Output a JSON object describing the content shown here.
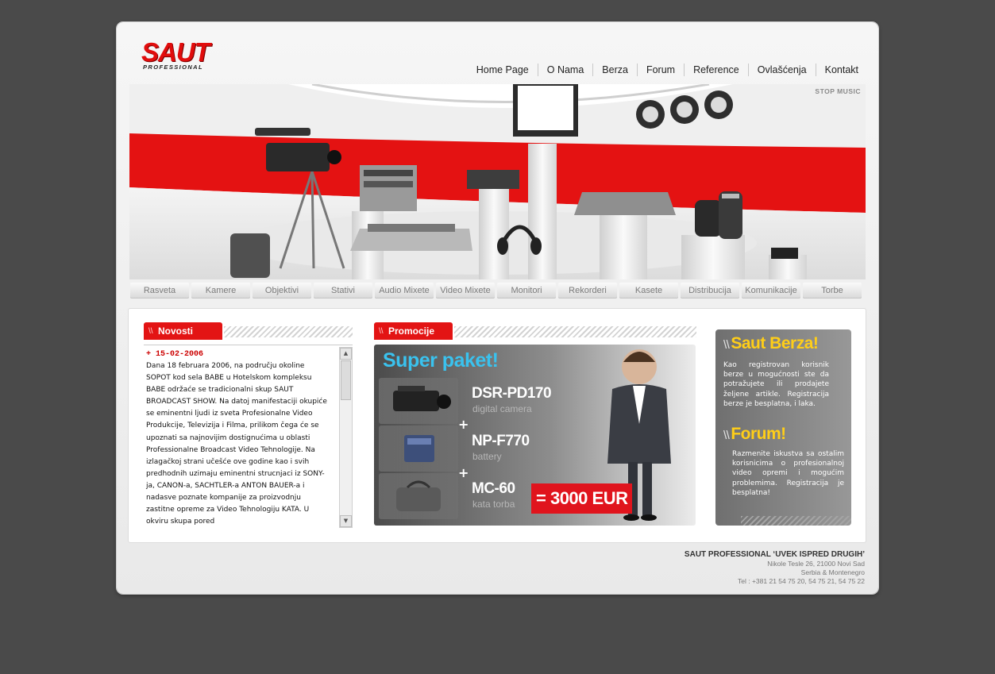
{
  "logo": {
    "main": "SAUT",
    "sub": "PROFESSIONAL"
  },
  "topnav": [
    "Home Page",
    "O Nama",
    "Berza",
    "Forum",
    "Reference",
    "Ovlašćenja",
    "Kontakt"
  ],
  "banner": {
    "stop_music": "STOP MUSIC"
  },
  "categories": [
    "Rasveta",
    "Kamere",
    "Objektivi",
    "Stativi",
    "Audio Mixete",
    "Video Mixete",
    "Monitori",
    "Rekorderi",
    "Kasete",
    "Distribucija",
    "Komunikacije",
    "Torbe"
  ],
  "news": {
    "tab": "Novosti",
    "date": "+ 15-02-2006",
    "text": "Dana 18 februara 2006, na području okoline SOPOT kod sela BABE u Hotelskom kompleksu BABE održaće se tradicionalni skup SAUT BROADCAST SHOW. Na datoj manifestaciji okupiće se eminentni ljudi iz sveta Profesionalne Video Produkcije, Televizija i Filma, prilikom čega će se upoznati sa najnovijim dostignućima u oblasti Professionalne Broadcast Video Tehnologije. Na izlagačkoj strani učešće ove godine kao i svih predhodnih uzimaju eminentni strucnjaci iz SONY-ja, CANON-a, SACHTLER-a ANTON BAUER-a i nadasve poznate kompanije za proizvodnju zastitne opreme za Video Tehnologiju KATA. U okviru skupa pored"
  },
  "promo": {
    "tab": "Promocije",
    "title": "Super paket!",
    "items": [
      {
        "name": "DSR-PD170",
        "desc": "digital camera"
      },
      {
        "name": "NP-F770",
        "desc": "battery"
      },
      {
        "name": "MC-60",
        "desc": "kata torba"
      }
    ],
    "price": "= 3000 EUR"
  },
  "side": {
    "berza_title": "Saut Berza!",
    "berza_text": "Kao registrovan korisnik berze u mogućnosti ste da potražujete ili prodajete željene artikle. Registracija berze je besplatna, i laka.",
    "forum_title": "Forum!",
    "forum_text": "Razmenite iskustva sa ostalim korisnicima o profesionalnoj video opremi i mogućim problemima. Registracija je besplatna!"
  },
  "footer": {
    "company": "SAUT PROFESSIONAL ‘UVEK ISPRED DRUGIH’",
    "address": "Nikole Tesle 26, 21000 Novi Sad",
    "country": "Serbia & Montenegro",
    "tel": "Tel : +381 21 54 75 20, 54 75 21, 54 75 22"
  },
  "colors": {
    "accent": "#e31414",
    "promo_title": "#3ac2ee",
    "side_heading": "#ffce18"
  }
}
